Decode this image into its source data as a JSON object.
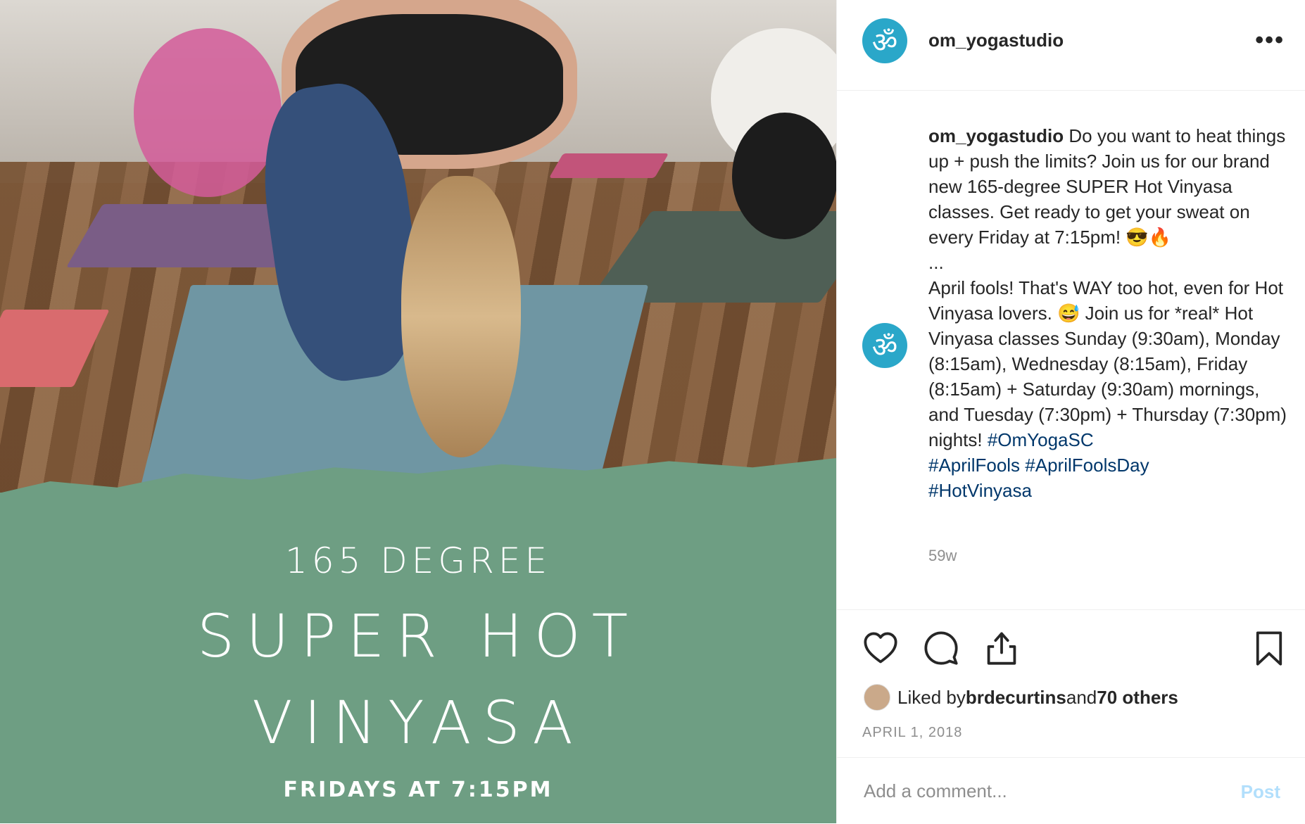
{
  "image": {
    "overlay": {
      "line1": "165 DEGREE",
      "line2": "SUPER HOT",
      "line3": "VINYASA",
      "line4": "FRIDAYS AT 7:15PM"
    },
    "banner_color": "#6e9e83"
  },
  "header": {
    "username": "om_yogastudio",
    "avatar_glyph": "ॐ",
    "more_label": "•••"
  },
  "caption": {
    "username": "om_yogastudio",
    "text1": " Do you want to heat things up + push the limits? Join us for our brand new 165-degree SUPER Hot Vinyasa classes. Get ready to get your sweat on every Friday at 7:15pm! 😎🔥",
    "ellipsis": "...",
    "text2": "April fools! That's WAY too hot, even for Hot Vinyasa lovers. 😅 Join us for *real* Hot Vinyasa classes Sunday (9:30am), Monday (8:15am), Wednesday (8:15am), Friday (8:15am) + Saturday (9:30am) mornings, and Tuesday (7:30pm) + Thursday (7:30pm) nights! ",
    "hashtags": [
      "#OmYogaSC",
      "#AprilFools",
      "#AprilFoolsDay",
      "#HotVinyasa"
    ],
    "time_ago": "59w"
  },
  "actions": {
    "icons": [
      "heart-icon",
      "comment-icon",
      "share-icon",
      "bookmark-icon"
    ],
    "liked_prefix": "Liked by ",
    "liked_user": "brdecurtins",
    "liked_mid": " and ",
    "liked_others": "70 others",
    "date": "APRIL 1, 2018"
  },
  "comment": {
    "placeholder": "Add a comment...",
    "post_label": "Post"
  },
  "colors": {
    "accent": "#2aa7c9",
    "hashtag": "#00376b",
    "post_disabled": "#b2dffc"
  }
}
